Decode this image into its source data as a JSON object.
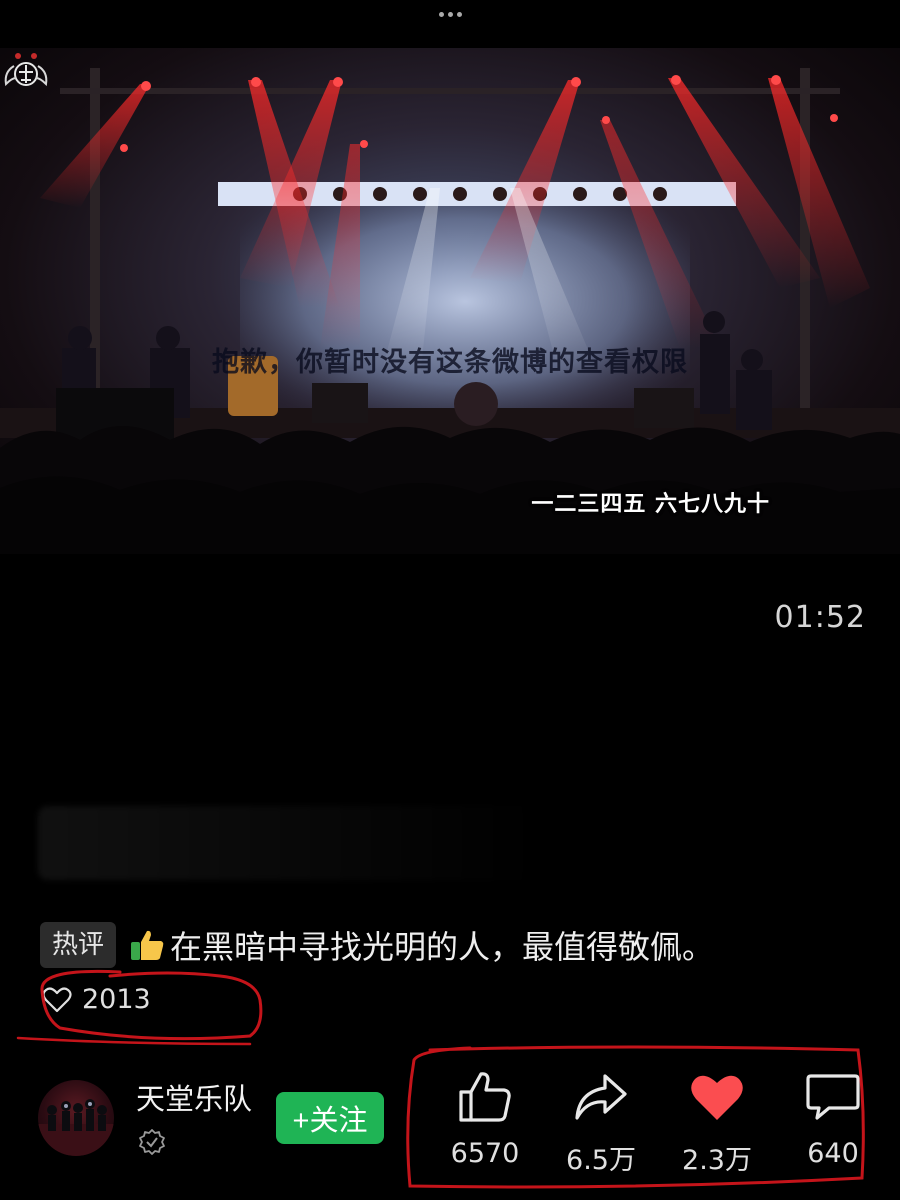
{
  "video": {
    "stage_caption": "抱歉，你暂时没有这条微博的查看权限",
    "subtitle": "一二三四五 六七八九十",
    "timestamp": "01:52"
  },
  "hot_comment": {
    "badge": "热评",
    "emoji_icon": "thumbs-up-emoji",
    "text": "在黑暗中寻找光明的人，最值得敬佩。",
    "likes": "2013"
  },
  "author": {
    "name": "天堂乐队",
    "follow_label": "+关注"
  },
  "actions": {
    "like_count": "6570",
    "share_count": "6.5万",
    "favorite_count": "2.3万",
    "comment_count": "640"
  },
  "colors": {
    "follow_green": "#1fb455",
    "favorite_red": "#fb4d50",
    "annotation_red": "#c4141a"
  }
}
